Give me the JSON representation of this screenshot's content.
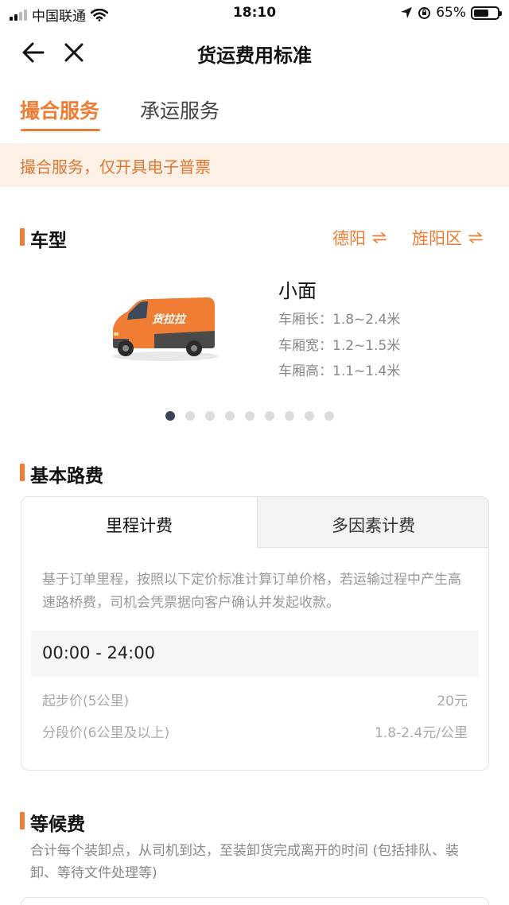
{
  "status_bar": {
    "carrier": "中国联通",
    "time": "18:10",
    "battery": "65%",
    "battery_level": 0.65
  },
  "nav": {
    "title": "货运费用标准",
    "back_icon": "arrow-left-icon",
    "close_icon": "close-icon"
  },
  "tabs": [
    {
      "label": "撮合服务",
      "active": true
    },
    {
      "label": "承运服务",
      "active": false
    }
  ],
  "notice": "撮合服务，仅开具电子普票",
  "vehicle_section": {
    "title": "车型",
    "from_city": "德阳",
    "to_city": "旌阳区",
    "vehicle": {
      "name": "小面",
      "specs": [
        "车厢长：1.8~2.4米",
        "车厢宽：1.2~1.5米",
        "车厢高：1.1~1.4米"
      ],
      "van_logo_text": "货拉拉"
    },
    "carousel": {
      "count": 9,
      "active_index": 0
    }
  },
  "fee_section": {
    "title": "基本路费",
    "tabs": [
      {
        "label": "里程计费",
        "active": true
      },
      {
        "label": "多因素计费",
        "active": false
      }
    ],
    "description": "基于订单里程，按照以下定价标准计算订单价格，若运输过程中产生高速路桥费，司机会凭票据向客户确认并发起收款。",
    "time_range": "00:00 - 24:00",
    "prices": [
      {
        "label": "起步价(5公里)",
        "value": "20元"
      },
      {
        "label": "分段价(6公里及以上)",
        "value": "1.8-2.4元/公里"
      }
    ]
  },
  "wait_section": {
    "title": "等候费",
    "description": "合计每个装卸点，从司机到达，至装卸货完成离开的时间 (包括排队、装卸、等待文件处理等)"
  },
  "colors": {
    "accent": "#f07d33",
    "notice_bg": "#fdf1e6",
    "dot_active": "#3c4356"
  }
}
